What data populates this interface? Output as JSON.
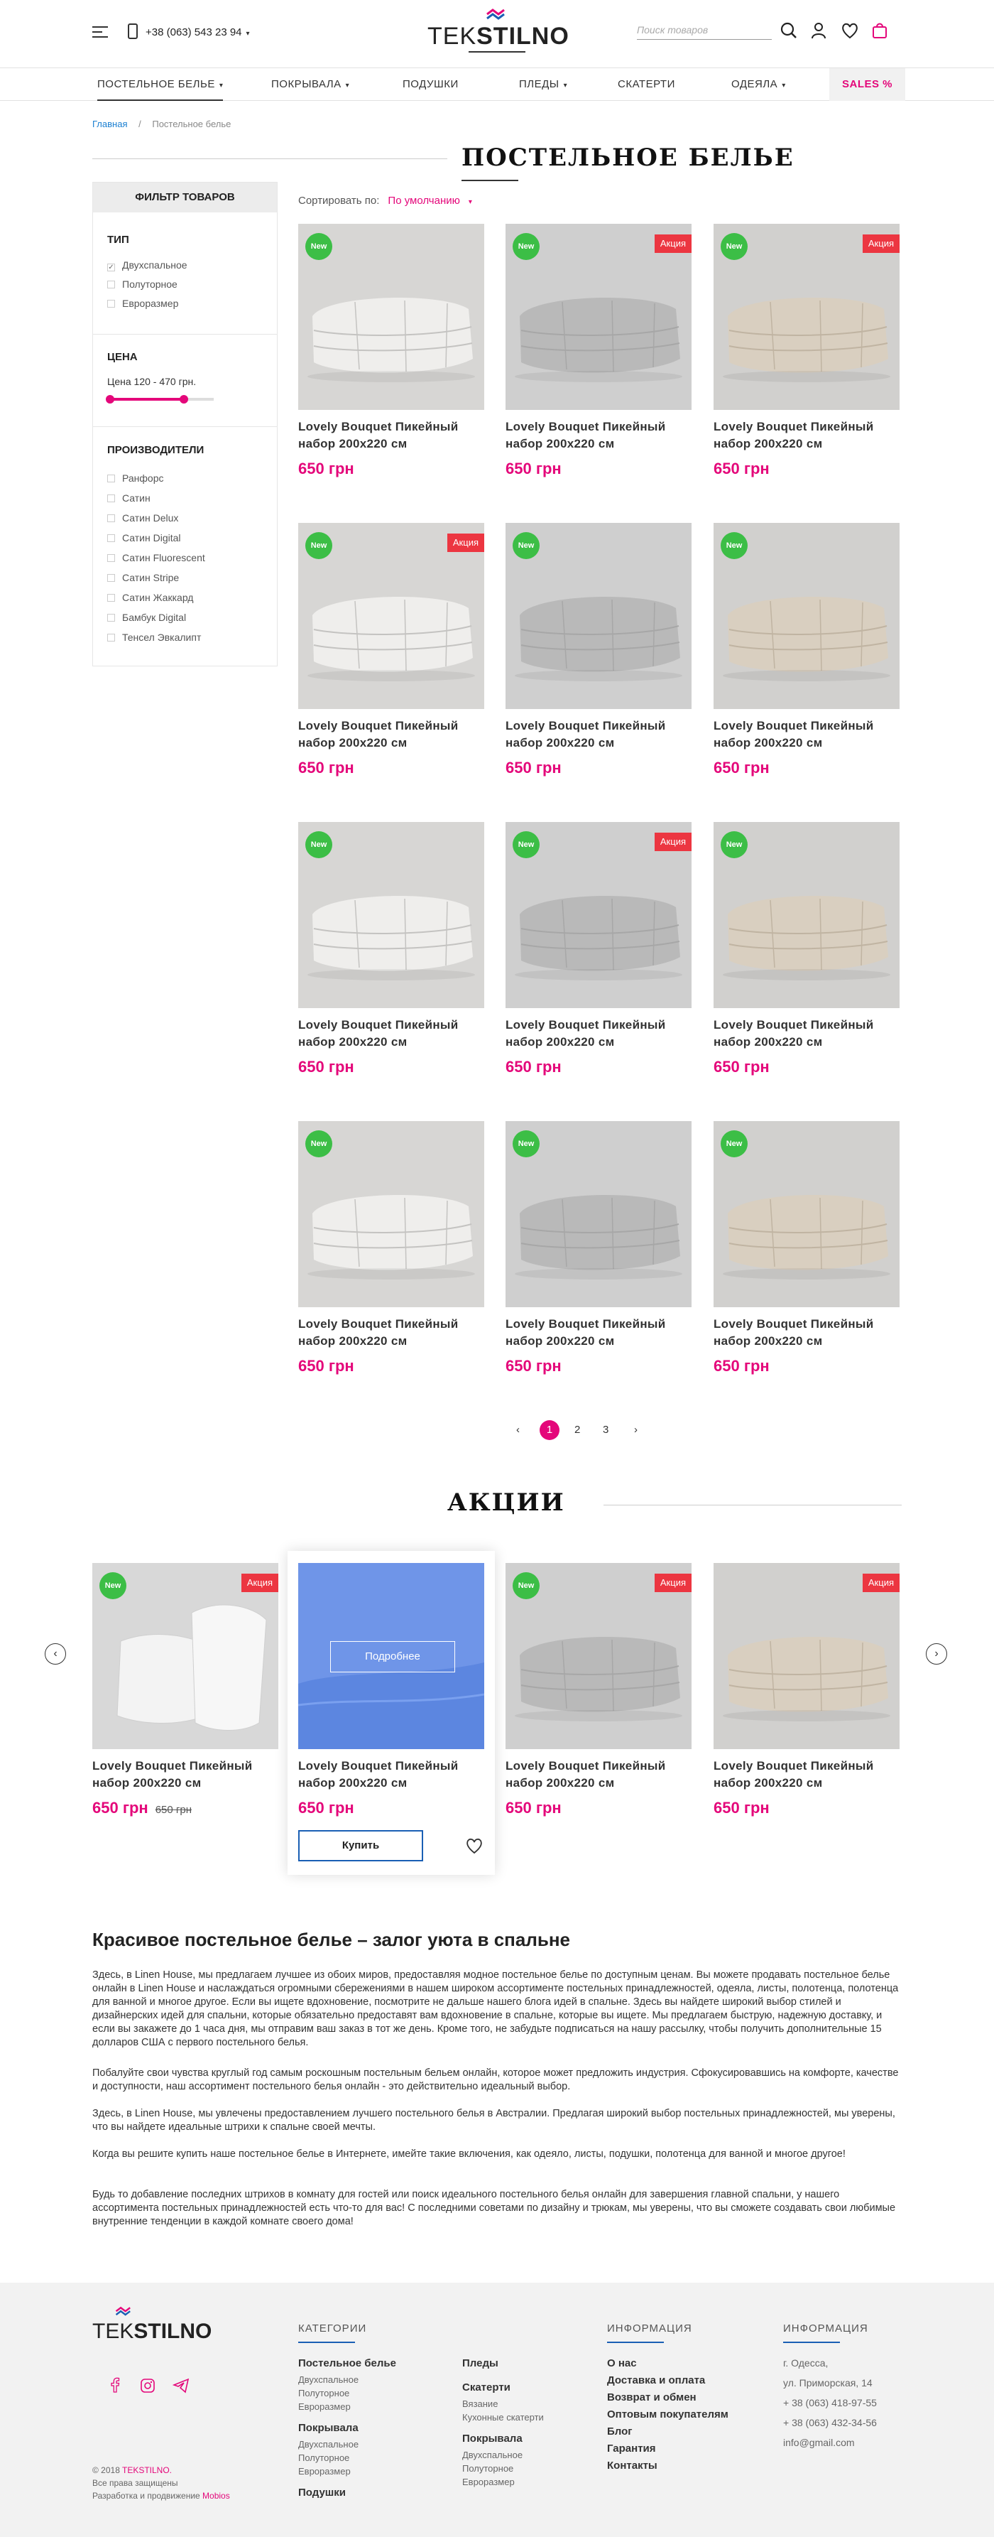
{
  "header": {
    "phone": "+38 (063) 543 23 94",
    "logo_light": "TEK",
    "logo_bold": "STILNO",
    "search_placeholder": "Поиск товаров"
  },
  "nav": {
    "items": [
      "ПОСТЕЛЬНОЕ БЕЛЬЕ",
      "ПОКРЫВАЛА",
      "ПОДУШКИ",
      "ПЛЕДЫ",
      "СКАТЕРТИ",
      "ОДЕЯЛА"
    ],
    "sales": "SALES %"
  },
  "breadcrumb": {
    "home": "Главная",
    "current": "Постельное белье"
  },
  "page_title": "ПОСТЕЛЬНОЕ БЕЛЬЕ",
  "filter": {
    "title": "ФИЛЬТР ТОВАРОВ",
    "type_label": "ТИП",
    "types": [
      "Двухспальное",
      "Полуторное",
      "Евроразмер"
    ],
    "price_label": "ЦЕНА",
    "price_range": "Цена 120 - 470 грн.",
    "price_fill_fraction": 0.72,
    "makers_label": "ПРОИЗВОДИТЕЛИ",
    "makers": [
      "Ранфорс",
      "Сатин",
      "Сатин Delux",
      "Сатин Digital",
      "Сатин Fluorescent",
      "Сатин Stripe",
      "Сатин Жаккард",
      "Бамбук Digital",
      "Тенсел Эвкалипт"
    ]
  },
  "sort": {
    "label": "Сортировать по:",
    "value": "По умолчанию"
  },
  "badges": {
    "new": "New",
    "sale": "Акция"
  },
  "product": {
    "name_1": "Lovely Bouquet Пикейный",
    "name_2": "набор 200x220 см",
    "price": "650 грн",
    "old_price": "650 грн"
  },
  "pagination": [
    "1",
    "2",
    "3"
  ],
  "akcii_title": "АКЦИИ",
  "akcii": {
    "more": "Подробнее",
    "buy": "Купить"
  },
  "seo": {
    "title": "Красивое постельное белье – залог уюта в спальне",
    "p1": "Здесь, в Linen House, мы предлагаем лучшее из обоих миров, предоставляя модное постельное белье по доступным ценам. Вы можете продавать постельное белье онлайн в Linen House и наслаждаться огромными сбережениями в нашем широком ассортименте постельных принадлежностей, одеяла, листы, полотенца, полотенца для ванной и многое другое. Если вы ищете вдохновение, посмотрите не дальше нашего блога идей в спальне. Здесь вы найдете широкий выбор стилей и дизайнерских идей для спальни, которые обязательно предоставят вам вдохновение в спальне, которые вы ищете. Мы предлагаем быструю, надежную доставку, и если вы закажете до 1 часа дня, мы отправим ваш заказ в тот же день. Кроме того, не забудьте подписаться на нашу рассылку, чтобы получить дополнительные 15 долларов США с первого постельного белья.",
    "p2": "Побалуйте свои чувства круглый год самым роскошным постельным бельем онлайн, которое может предложить индустрия. Сфокусировавшись на комфорте, качестве и доступности, наш ассортимент постельного белья онлайн - это действительно идеальный выбор.",
    "p3": "Здесь, в Linen House, мы увлечены предоставлением лучшего постельного белья в Австралии. Предлагая широкий выбор постельных принадлежностей, мы уверены, что вы найдете идеальные штрихи к спальне своей мечты.",
    "p4": "Когда вы решите купить наше постельное белье в Интернете, имейте такие включения, как одеяло, листы, подушки, полотенца для ванной и многое другое!",
    "p5": "Будь то добавление последних штрихов в комнату для гостей или поиск идеального постельного белья онлайн для завершения главной спальни, у нашего ассортимента постельных принадлежностей есть что-то для вас! С последними советами по дизайну и трюкам, мы уверены, что вы сможете создавать свои любимые внутренние тенденции в каждой комнате своего дома!"
  },
  "footer": {
    "cat_title": "КАТЕГОРИИ",
    "info_title": "ИНФОРМАЦИЯ",
    "contact_title": "ИНФОРМАЦИЯ",
    "col1": [
      {
        "h": "Постельное белье",
        "items": [
          "Двухспальное",
          "Полуторное",
          "Евроразмер"
        ]
      },
      {
        "h": "Покрывала",
        "items": [
          "Двухспальное",
          "Полуторное",
          "Евроразмер"
        ]
      },
      {
        "h": "Подушки",
        "items": []
      }
    ],
    "col2": [
      {
        "h": "Пледы",
        "items": []
      },
      {
        "h": "Скатерти",
        "items": [
          "Вязание",
          "Кухонные скатерти"
        ]
      },
      {
        "h": "Покрывала",
        "items": [
          "Двухспальное",
          "Полуторное",
          "Евроразмер"
        ]
      }
    ],
    "info": [
      "О нас",
      "Доставка и оплата",
      "Возврат и обмен",
      "Оптовым покупателям",
      "Блог",
      "Гарантия",
      "Контакты"
    ],
    "contacts": [
      "г. Одесса,",
      "ул. Приморская, 14",
      "+ 38 (063) 418-97-55",
      "+ 38 (063) 432-34-56",
      "info@gmail.com"
    ],
    "copyright": "© 2018",
    "copyright_brand": "TEKSTILNO.",
    "rights": "Все права защищены",
    "dev": "Разработка и продвижение",
    "dev_brand": "Mobios"
  },
  "colors": {
    "accent": "#e4077a",
    "new": "#3cbe46",
    "sale": "#ec3641",
    "blue": "#1a5fb4"
  }
}
